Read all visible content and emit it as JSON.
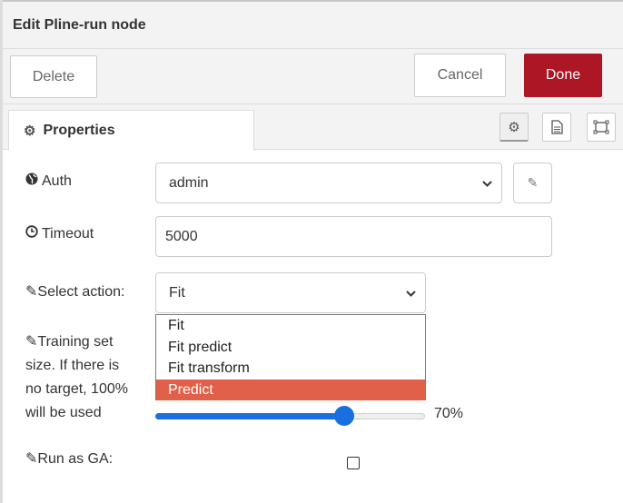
{
  "dialog": {
    "title": "Edit Pline-run node"
  },
  "toolbar": {
    "delete_label": "Delete",
    "cancel_label": "Cancel",
    "done_label": "Done",
    "done_color": "#ad1625"
  },
  "tabs": {
    "properties_label": "Properties"
  },
  "fields": {
    "auth": {
      "label": "Auth",
      "value": "admin"
    },
    "timeout": {
      "label": "Timeout",
      "value": "5000"
    },
    "action": {
      "label": "Select action:",
      "value": "Fit",
      "options": [
        "Fit",
        "Fit predict",
        "Fit transform",
        "Predict"
      ],
      "highlighted": "Predict",
      "highlight_color": "#e0604a"
    },
    "training": {
      "label_lines": [
        "Training set",
        "size. If there is",
        "no target, 100%",
        "will be used"
      ],
      "value_label": "70%",
      "fraction": 0.7,
      "slider_color": "#1a6fe0"
    },
    "run_as_ga": {
      "label": "Run as GA:",
      "checked": false
    }
  },
  "icons": {
    "gear": "gear-icon",
    "document": "document-icon",
    "frame": "frame-icon",
    "globe": "globe-icon",
    "clock": "clock-icon",
    "pencil": "pencil-icon"
  }
}
